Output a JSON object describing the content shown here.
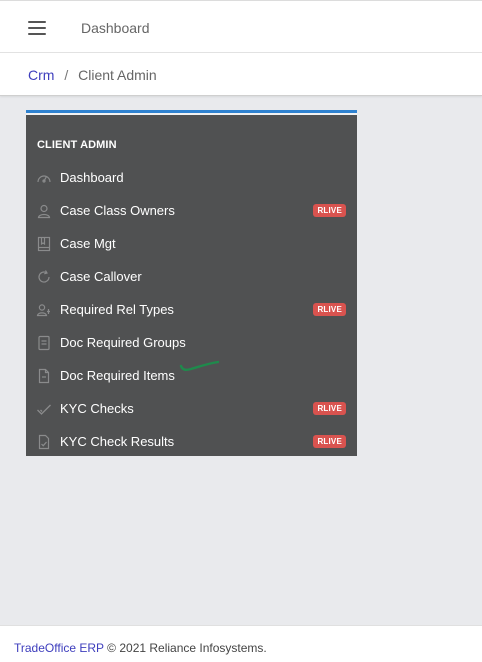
{
  "topbar": {
    "menu_icon": "hamburger-icon",
    "link": "Dashboard"
  },
  "breadcrumb": {
    "root": "Crm",
    "separator": "/",
    "current": "Client Admin"
  },
  "panel": {
    "accent_color": "#2f82d0",
    "title": "CLIENT ADMIN",
    "items": [
      {
        "label": "Dashboard",
        "icon": "speedometer-icon",
        "badge": ""
      },
      {
        "label": "Case Class Owners",
        "icon": "user-icon",
        "badge": "RLIVE"
      },
      {
        "label": "Case Mgt",
        "icon": "book-icon",
        "badge": ""
      },
      {
        "label": "Case Callover",
        "icon": "refresh-icon",
        "badge": ""
      },
      {
        "label": "Required Rel Types",
        "icon": "user-link-icon",
        "badge": "RLIVE"
      },
      {
        "label": "Doc Required Groups",
        "icon": "document-list-icon",
        "badge": ""
      },
      {
        "label": "Doc Required Items",
        "icon": "document-icon",
        "badge": ""
      },
      {
        "label": "KYC Checks",
        "icon": "check-icon",
        "badge": "RLIVE"
      },
      {
        "label": "KYC Check Results",
        "icon": "document-check-icon",
        "badge": "RLIVE"
      }
    ],
    "badge_color": "#d9534f"
  },
  "footer": {
    "link": "TradeOffice ERP",
    "text": "© 2021 Reliance Infosystems."
  }
}
